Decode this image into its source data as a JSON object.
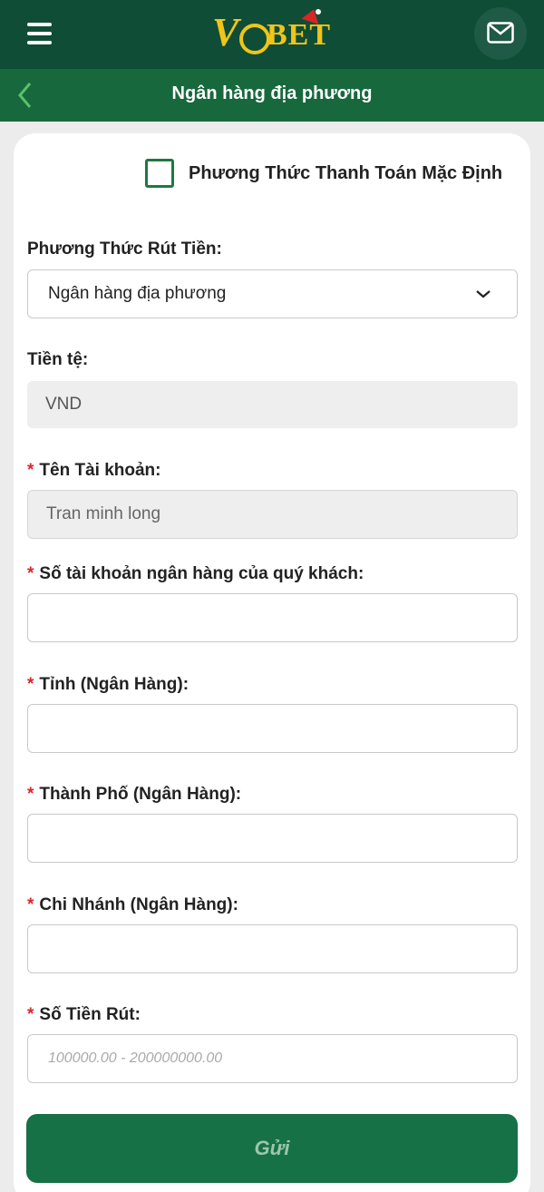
{
  "header": {
    "logo_text": "V9BET",
    "title": "Ngân hàng địa phương",
    "menu_icon": "hamburger-icon",
    "mail_icon": "mail-icon",
    "back_icon": "chevron-left-icon",
    "colors": {
      "topbar": "#0f4d37",
      "titlebar": "#18683d",
      "logo": "#f0c419"
    }
  },
  "form": {
    "default_method_label": "Phương Thức Thanh Toán Mặc Định",
    "default_method_checked": false,
    "withdraw_method": {
      "label": "Phương Thức Rút Tiền:",
      "value": "Ngân hàng địa phương"
    },
    "currency": {
      "label": "Tiền tệ:",
      "value": "VND"
    },
    "account_name": {
      "required": "*",
      "label": "Tên Tài khoản:",
      "value": "Tran minh long"
    },
    "bank_account_number": {
      "required": "*",
      "label": "Số tài khoản ngân hàng của quý khách:",
      "value": ""
    },
    "province": {
      "required": "*",
      "label": "Tỉnh (Ngân Hàng):",
      "value": ""
    },
    "city": {
      "required": "*",
      "label": "Thành Phố (Ngân Hàng):",
      "value": ""
    },
    "branch": {
      "required": "*",
      "label": "Chi Nhánh (Ngân Hàng):",
      "value": ""
    },
    "amount": {
      "required": "*",
      "label": "Số Tiền Rút:",
      "placeholder": "100000.00 - 200000000.00"
    },
    "submit_label": "Gửi",
    "colors": {
      "submit": "#167246",
      "required": "#d9262c",
      "checkbox": "#1c7a3f"
    }
  }
}
